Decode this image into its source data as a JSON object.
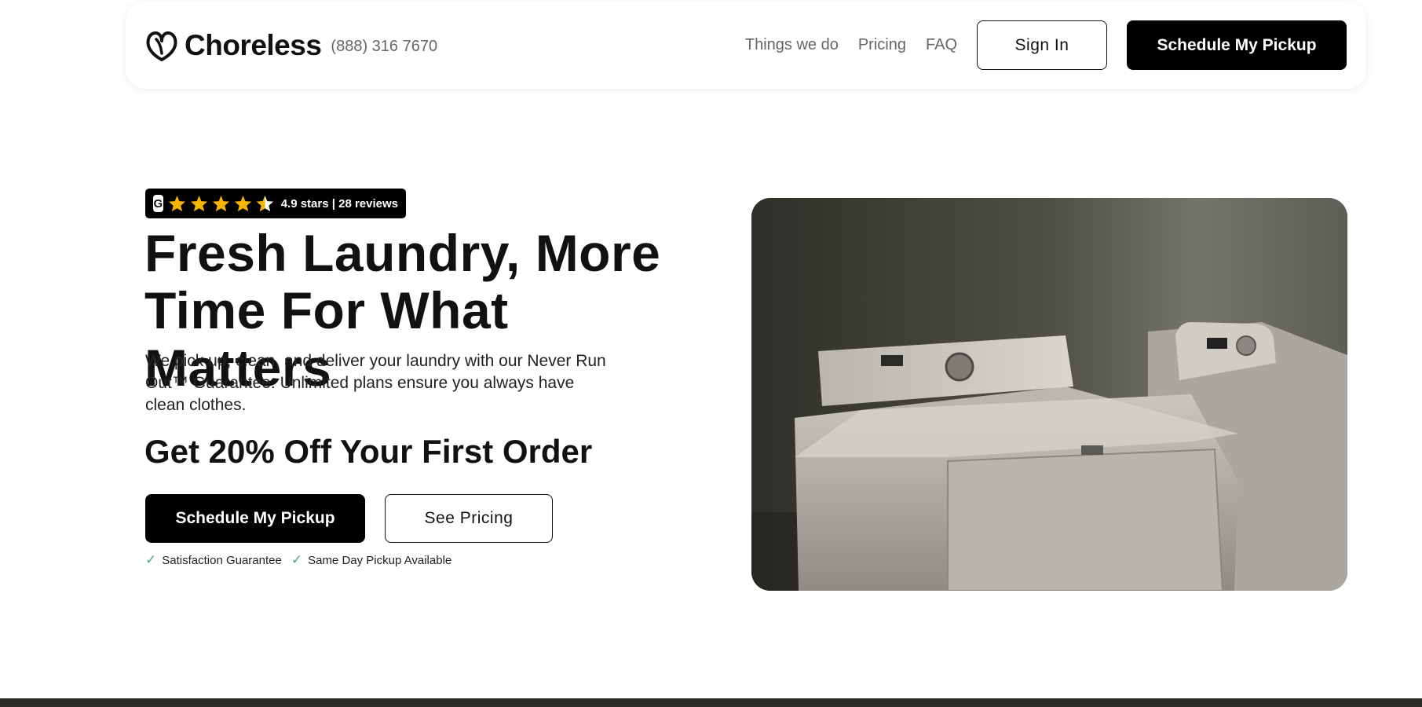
{
  "header": {
    "brand": "Choreless",
    "phone": "(888) 316 7670",
    "nav": [
      "Things we do",
      "Pricing",
      "FAQ"
    ],
    "signin_label": "Sign In",
    "cta_label": "Schedule My Pickup"
  },
  "rating": {
    "badge_letter": "G",
    "stars": 4.5,
    "text": "4.9 stars | 28 reviews"
  },
  "hero": {
    "title_line1": "Fresh Laundry, More",
    "title_line2": "Time For What Matters",
    "subtitle": "We pick up, clean, and deliver your laundry with our Never Run Out™ Guarantee. Unlimited plans ensure you always have clean clothes.",
    "promo": "Get 20% Off Your First Order",
    "cta_label": "Schedule My Pickup",
    "pricing_label": "See Pricing",
    "features": [
      "Satisfaction Guarantee",
      "Same Day Pickup Available"
    ]
  },
  "colors": {
    "accent": "#000000",
    "star": "#f5b400",
    "check": "#4aa59a"
  }
}
